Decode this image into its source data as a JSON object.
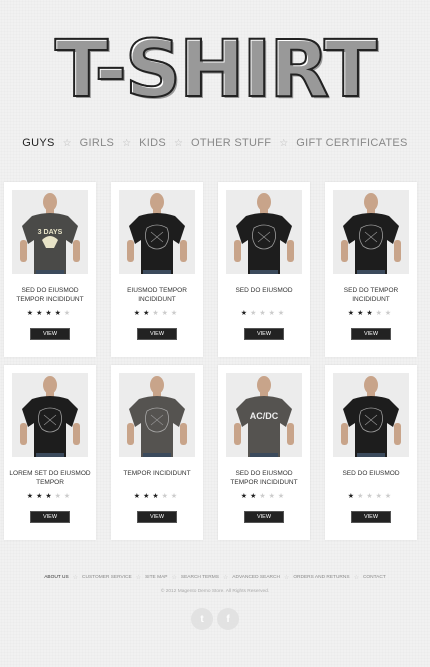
{
  "logo": {
    "text": "T-SHIRT"
  },
  "nav": {
    "items": [
      {
        "label": "GUYS",
        "active": true
      },
      {
        "label": "GIRLS",
        "active": false
      },
      {
        "label": "KIDS",
        "active": false
      },
      {
        "label": "OTHER STUFF",
        "active": false
      },
      {
        "label": "GIFT CERTIFICATES",
        "active": false
      }
    ],
    "separator": "☆"
  },
  "products": [
    {
      "name": "SED DO EIUSMOD TEMPOR INCIDIDUNT",
      "rating": 4,
      "max": 5,
      "view": "VIEW",
      "shirt": "dark-gray",
      "print": "3DAYS"
    },
    {
      "name": "EIUSMOD TEMPOR INCIDIDUNT",
      "rating": 2,
      "max": 5,
      "view": "VIEW",
      "shirt": "black",
      "print": ""
    },
    {
      "name": "SED DO EIUSMOD",
      "rating": 1,
      "max": 5,
      "view": "VIEW",
      "shirt": "black",
      "print": ""
    },
    {
      "name": "SED DO TEMPOR INCIDIDUNT",
      "rating": 3,
      "max": 5,
      "view": "VIEW",
      "shirt": "black",
      "print": ""
    },
    {
      "name": "LOREM SET DO EIUSMOD TEMPOR",
      "rating": 3,
      "max": 5,
      "view": "VIEW",
      "shirt": "black",
      "print": ""
    },
    {
      "name": "TEMPOR INCIDIDUNT",
      "rating": 3,
      "max": 5,
      "view": "VIEW",
      "shirt": "charcoal",
      "print": ""
    },
    {
      "name": "SED DO EIUSMOD TEMPOR INCIDIDUNT",
      "rating": 2,
      "max": 5,
      "view": "VIEW",
      "shirt": "charcoal",
      "print": "AC/DC"
    },
    {
      "name": "SED DO EIUSMOD",
      "rating": 1,
      "max": 5,
      "view": "VIEW",
      "shirt": "black",
      "print": ""
    }
  ],
  "footer": {
    "links": [
      {
        "label": "ABOUT US",
        "active": true
      },
      {
        "label": "CUSTOMER SERVICE",
        "active": false
      },
      {
        "label": "SITE MAP",
        "active": false
      },
      {
        "label": "SEARCH TERMS",
        "active": false
      },
      {
        "label": "ADVANCED SEARCH",
        "active": false
      },
      {
        "label": "ORDERS AND RETURNS",
        "active": false
      },
      {
        "label": "CONTACT",
        "active": false
      }
    ],
    "separator": "☆",
    "copyright": "© 2012 Magento Demo Store. All Rights Reserved.",
    "social": [
      {
        "icon": "twitter-icon",
        "glyph": "t"
      },
      {
        "icon": "facebook-icon",
        "glyph": "f"
      }
    ]
  },
  "colors": {
    "background": "#f1f1f1",
    "button": "#222222",
    "star_on": "#222222",
    "star_off": "#cccccc"
  }
}
